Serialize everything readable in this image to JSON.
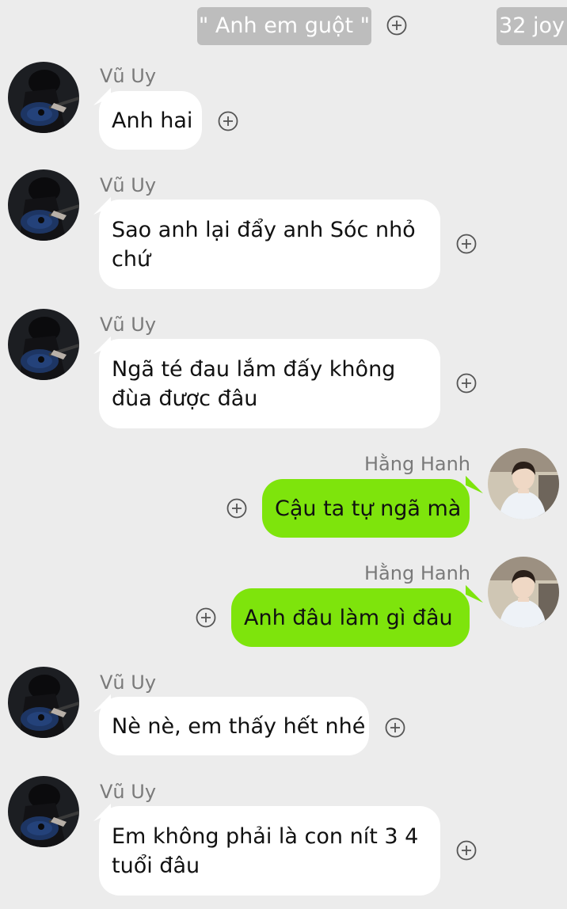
{
  "header": {
    "group_name": "\" Anh em guột \"",
    "count": "32 joy"
  },
  "messages": [
    {
      "sender": "Vũ Uy",
      "text": "Anh hai",
      "direction": "incoming"
    },
    {
      "sender": "Vũ Uy",
      "text": "Sao anh lại đẩy anh Sóc nhỏ chứ",
      "direction": "incoming"
    },
    {
      "sender": "Vũ Uy",
      "text": "Ngã té đau lắm đấy không đùa được đâu",
      "direction": "incoming"
    },
    {
      "sender": "Hằng Hanh",
      "text": "Cậu ta tự ngã mà",
      "direction": "outgoing"
    },
    {
      "sender": "Hằng Hanh",
      "text": "Anh đâu làm gì đâu",
      "direction": "outgoing"
    },
    {
      "sender": "Vũ Uy",
      "text": "Nè nè, em thấy hết nhé",
      "direction": "incoming"
    },
    {
      "sender": "Vũ Uy",
      "text": "Em không phải là con nít 3 4 tuổi đâu",
      "direction": "incoming"
    }
  ],
  "colors": {
    "background": "#ececec",
    "incoming_bubble": "#ffffff",
    "outgoing_bubble": "#7ee40c",
    "header_pill": "#bdbdbd"
  },
  "icons": {
    "add": "plus-circle-icon",
    "avatar_incoming": "guitar-player-avatar",
    "avatar_outgoing": "boy-portrait-avatar"
  }
}
